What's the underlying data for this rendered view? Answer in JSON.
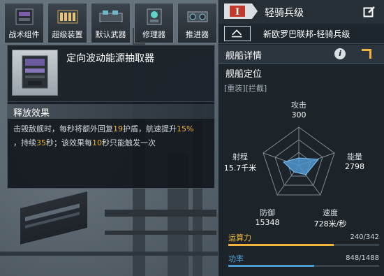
{
  "slots": [
    {
      "label": "战术组件",
      "icon": "tactical-module-icon"
    },
    {
      "label": "超级装置",
      "icon": "super-device-icon"
    },
    {
      "label": "默认武器",
      "icon": "default-weapon-icon"
    },
    {
      "label": "修理器",
      "icon": "repair-module-icon"
    },
    {
      "label": "推进器",
      "icon": "thruster-icon"
    }
  ],
  "tooltip": {
    "title": "定向波动能源抽取器",
    "section_title": "释放效果",
    "description": {
      "p1": "击毁敌舰时，每秒将额外回复",
      "v1": "19",
      "p2": "护盾，航速提升",
      "v2": "15%",
      "p3": "，持续",
      "v3": "35",
      "p4": "秒；该效果每",
      "v4": "10",
      "p5": "秒只能触发一次"
    }
  },
  "panel": {
    "tier_badge": "I",
    "class_name": "轻骑兵级",
    "hull_name": "新欧罗巴联邦-轻骑兵级",
    "details_title": "舰船详情",
    "positioning_title": "舰船定位",
    "positioning_tags": "[重装][拦截]",
    "stats": {
      "attack": {
        "label": "攻击",
        "value": "300"
      },
      "energy": {
        "label": "能量",
        "value": "2798"
      },
      "speed": {
        "label": "速度",
        "value": "728米/秒"
      },
      "defense": {
        "label": "防御",
        "value": "15348"
      },
      "range": {
        "label": "射程",
        "value": "15.7千米"
      }
    },
    "computing": {
      "label": "运算力",
      "value": "240/342",
      "fraction": 0.7,
      "color": "#f0b43c"
    },
    "power": {
      "label": "功率",
      "value": "848/1488",
      "fraction": 0.57,
      "color": "#4a9ad4"
    },
    "accent": "#f0b43c",
    "tier_color": "#c0392b"
  }
}
